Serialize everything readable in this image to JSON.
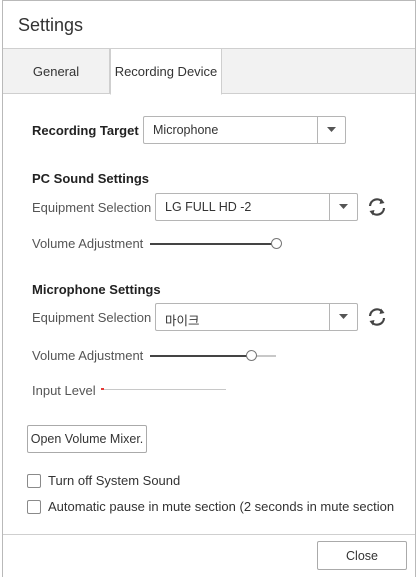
{
  "window": {
    "title": "Settings"
  },
  "tabs": [
    {
      "label": "General",
      "selected": false
    },
    {
      "label": "Recording Device",
      "selected": true
    }
  ],
  "recording_target": {
    "label": "Recording Target",
    "value": "Microphone"
  },
  "pc_sound": {
    "heading": "PC Sound Settings",
    "equipment_label": "Equipment Selection",
    "equipment_value": "LG FULL HD -2",
    "volume_label": "Volume Adjustment",
    "volume_fraction": 1.0
  },
  "microphone": {
    "heading": "Microphone Settings",
    "equipment_label": "Equipment Selection",
    "equipment_value": "마이크",
    "volume_label": "Volume Adjustment",
    "volume_fraction": 0.8,
    "input_level_label": "Input Level",
    "input_level_fraction": 0.02
  },
  "buttons": {
    "open_mixer": "Open Volume Mixer.",
    "close": "Close"
  },
  "options": {
    "turn_off_system_sound": {
      "label": "Turn off System Sound",
      "checked": false
    },
    "auto_pause": {
      "label": "Automatic pause in mute section (2 seconds in mute section",
      "checked": false
    }
  },
  "icons": {
    "dropdown": "chevron-down-icon",
    "refresh": "refresh-icon"
  }
}
